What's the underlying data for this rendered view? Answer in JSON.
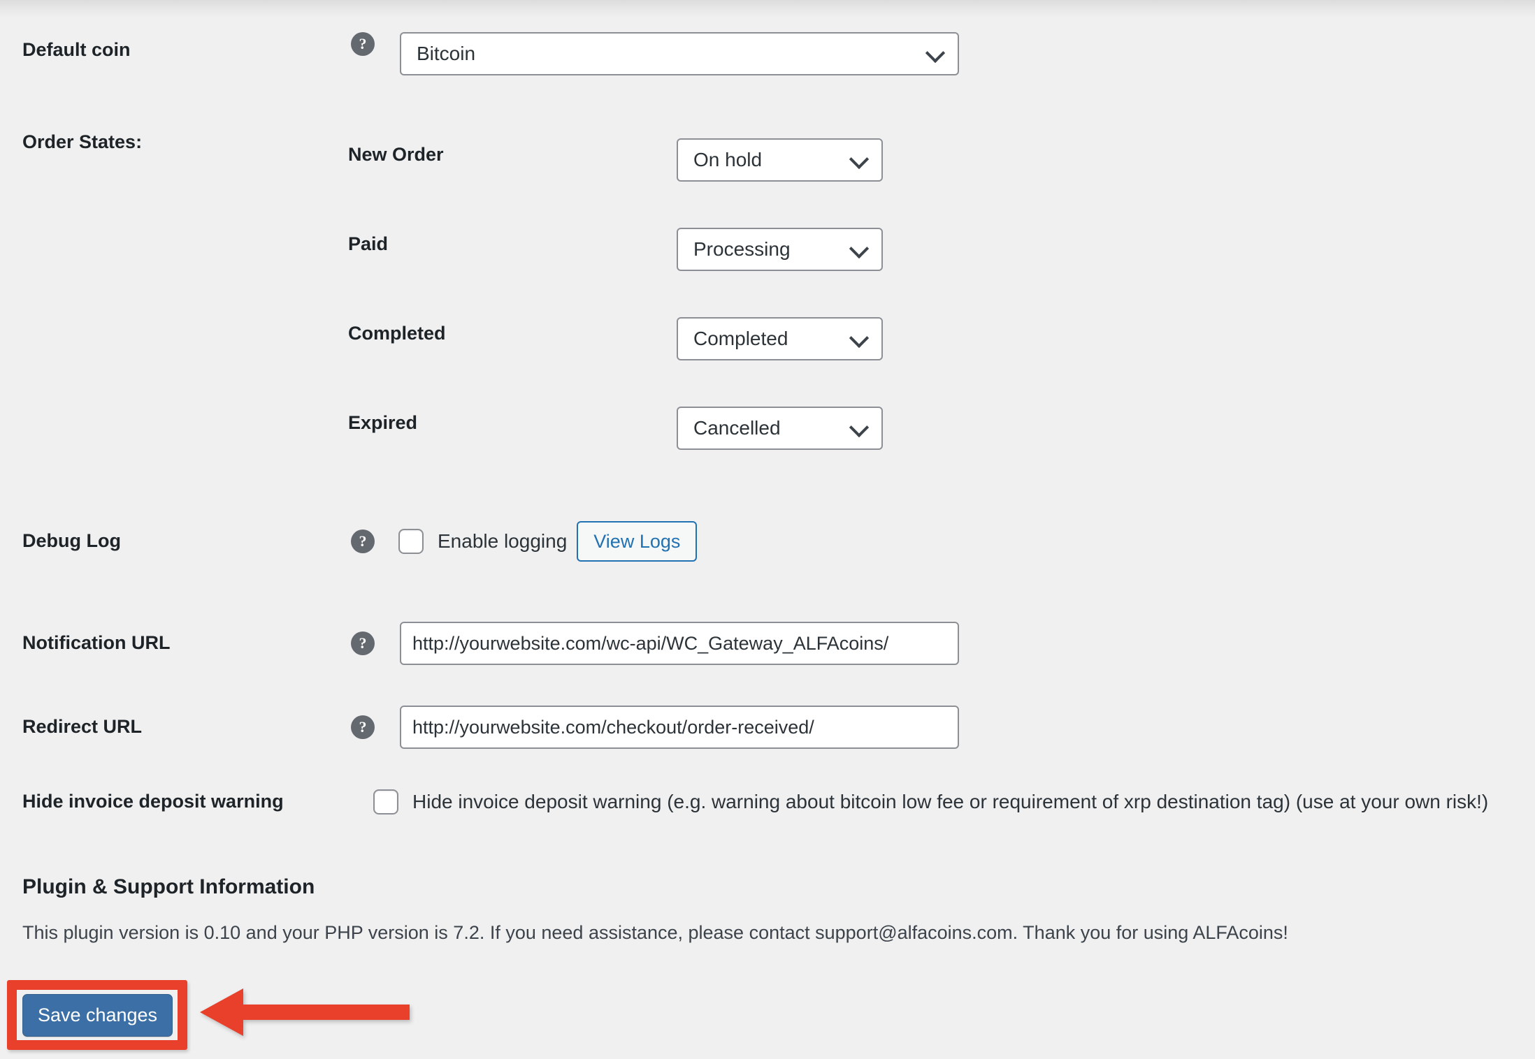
{
  "form": {
    "default_coin": {
      "label": "Default coin",
      "help_icon": "help-icon",
      "value": "Bitcoin"
    },
    "order_states": {
      "label": "Order States:",
      "rows": [
        {
          "label": "New Order",
          "value": "On hold"
        },
        {
          "label": "Paid",
          "value": "Processing"
        },
        {
          "label": "Completed",
          "value": "Completed"
        },
        {
          "label": "Expired",
          "value": "Cancelled"
        }
      ]
    },
    "debug_log": {
      "label": "Debug Log",
      "checkbox_label": "Enable logging",
      "checked": false,
      "button_label": "View Logs"
    },
    "notification_url": {
      "label": "Notification URL",
      "value": "http://yourwebsite.com/wc-api/WC_Gateway_ALFAcoins/"
    },
    "redirect_url": {
      "label": "Redirect URL",
      "value": "http://yourwebsite.com/checkout/order-received/"
    },
    "hide_invoice_warning": {
      "label": "Hide invoice deposit warning",
      "checkbox_label": "Hide invoice deposit warning (e.g. warning about bitcoin low fee or requirement of xrp destination tag) (use at your own risk!)",
      "checked": false
    }
  },
  "plugin_info": {
    "title": "Plugin & Support Information",
    "text": "This plugin version is 0.10 and your PHP version is 7.2. If you need assistance, please contact support@alfacoins.com. Thank you for using ALFAcoins!"
  },
  "actions": {
    "save_label": "Save changes"
  },
  "annotation": {
    "highlight_color": "#e8402a",
    "arrow_direction": "left",
    "target": "save-changes-button"
  },
  "colors": {
    "page_background": "#f0f0f1",
    "primary_button": "#3c6fa5",
    "link": "#2271b1",
    "annotation_red": "#e8402a",
    "help_bubble": "#646970",
    "input_border": "#8c8f94"
  }
}
